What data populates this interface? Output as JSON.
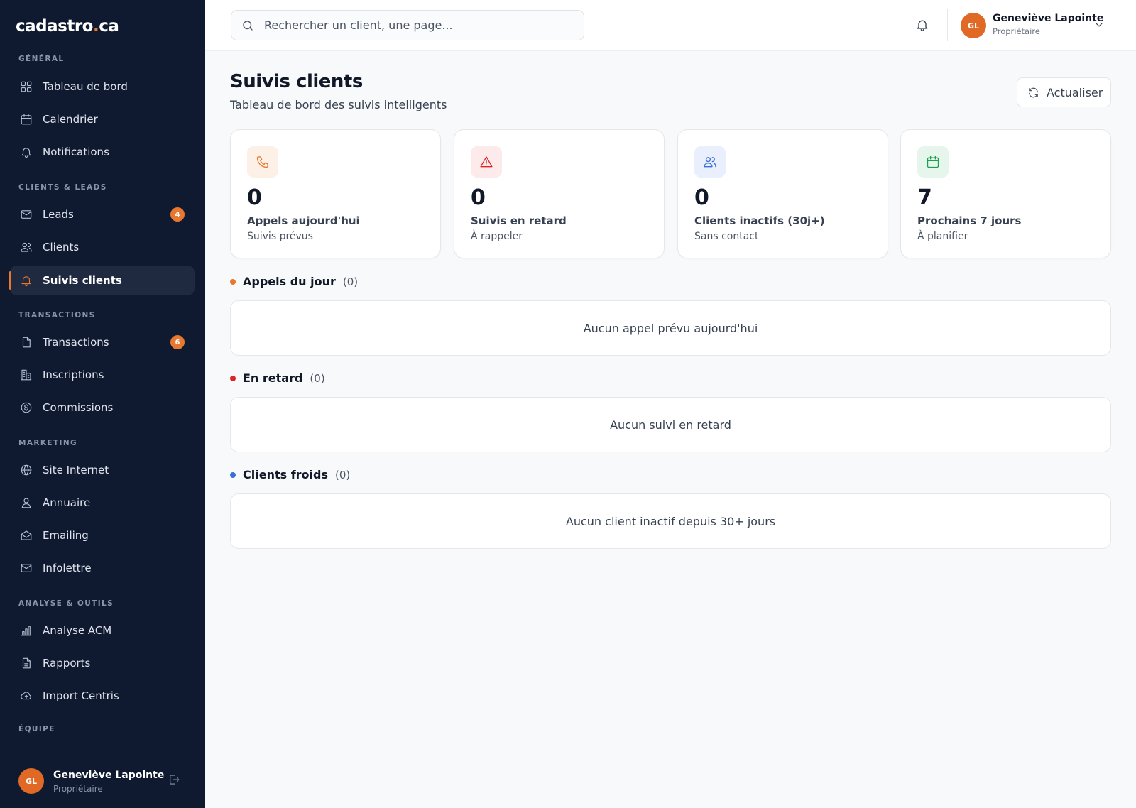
{
  "brand": {
    "name": "cadastro",
    "dot": ".",
    "tld": "ca"
  },
  "sidebar": {
    "sections": {
      "general": "GÉNÉRAL",
      "clients": "CLIENTS & LEADS",
      "transactions": "TRANSACTIONS",
      "marketing": "MARKETING",
      "analyse": "ANALYSE & OUTILS",
      "equipe": "ÉQUIPE"
    },
    "items": {
      "tableau": {
        "label": "Tableau de bord",
        "icon": "grid-icon"
      },
      "calendrier": {
        "label": "Calendrier",
        "icon": "calendar-icon"
      },
      "notifications": {
        "label": "Notifications",
        "icon": "bell-icon"
      },
      "leads": {
        "label": "Leads",
        "icon": "mail-icon",
        "badge": "4"
      },
      "clients": {
        "label": "Clients",
        "icon": "users-icon"
      },
      "suivis": {
        "label": "Suivis clients",
        "icon": "bell-icon",
        "active": true
      },
      "transactions": {
        "label": "Transactions",
        "icon": "file-icon",
        "badge": "6"
      },
      "inscriptions": {
        "label": "Inscriptions",
        "icon": "building-icon"
      },
      "commissions": {
        "label": "Commissions",
        "icon": "dollar-icon"
      },
      "site": {
        "label": "Site Internet",
        "icon": "globe-icon"
      },
      "annuaire": {
        "label": "Annuaire",
        "icon": "user-icon"
      },
      "emailing": {
        "label": "Emailing",
        "icon": "mail-open-icon"
      },
      "infolettre": {
        "label": "Infolettre",
        "icon": "mail-icon"
      },
      "acm": {
        "label": "Analyse ACM",
        "icon": "bar-chart-icon"
      },
      "rapports": {
        "label": "Rapports",
        "icon": "report-icon"
      },
      "centris": {
        "label": "Import Centris",
        "icon": "cloud-upload-icon"
      }
    },
    "user": {
      "initials": "GL",
      "name": "Geneviève Lapointe",
      "role": "Propriétaire"
    }
  },
  "topbar": {
    "search_placeholder": "Rechercher un client, une page...",
    "user": {
      "initials": "GL",
      "name": "Geneviève Lapointe",
      "role": "Propriétaire"
    }
  },
  "page": {
    "title": "Suivis clients",
    "subtitle": "Tableau de bord des suivis intelligents",
    "refresh_label": "Actualiser"
  },
  "stats": [
    {
      "value": "0",
      "label": "Appels aujourd'hui",
      "sub": "Suivis prévus",
      "icon": "phone-icon",
      "color": "#e8782f",
      "bg": "#fdf0e6"
    },
    {
      "value": "0",
      "label": "Suivis en retard",
      "sub": "À rappeler",
      "icon": "alert-triangle-icon",
      "color": "#dc2626",
      "bg": "#fdeaea"
    },
    {
      "value": "0",
      "label": "Clients inactifs (30j+)",
      "sub": "Sans contact",
      "icon": "users-icon",
      "color": "#3b6fd8",
      "bg": "#e9effc"
    },
    {
      "value": "7",
      "label": "Prochains 7 jours",
      "sub": "À planifier",
      "icon": "calendar-icon",
      "color": "#16a34a",
      "bg": "#e6f6ec"
    }
  ],
  "sections": [
    {
      "title": "Appels du jour",
      "count": "(0)",
      "empty": "Aucun appel prévu aujourd'hui",
      "color": "#e8782f"
    },
    {
      "title": "En retard",
      "count": "(0)",
      "empty": "Aucun suivi en retard",
      "color": "#dc2626"
    },
    {
      "title": "Clients froids",
      "count": "(0)",
      "empty": "Aucun client inactif depuis 30+ jours",
      "color": "#3b6fd8"
    }
  ]
}
